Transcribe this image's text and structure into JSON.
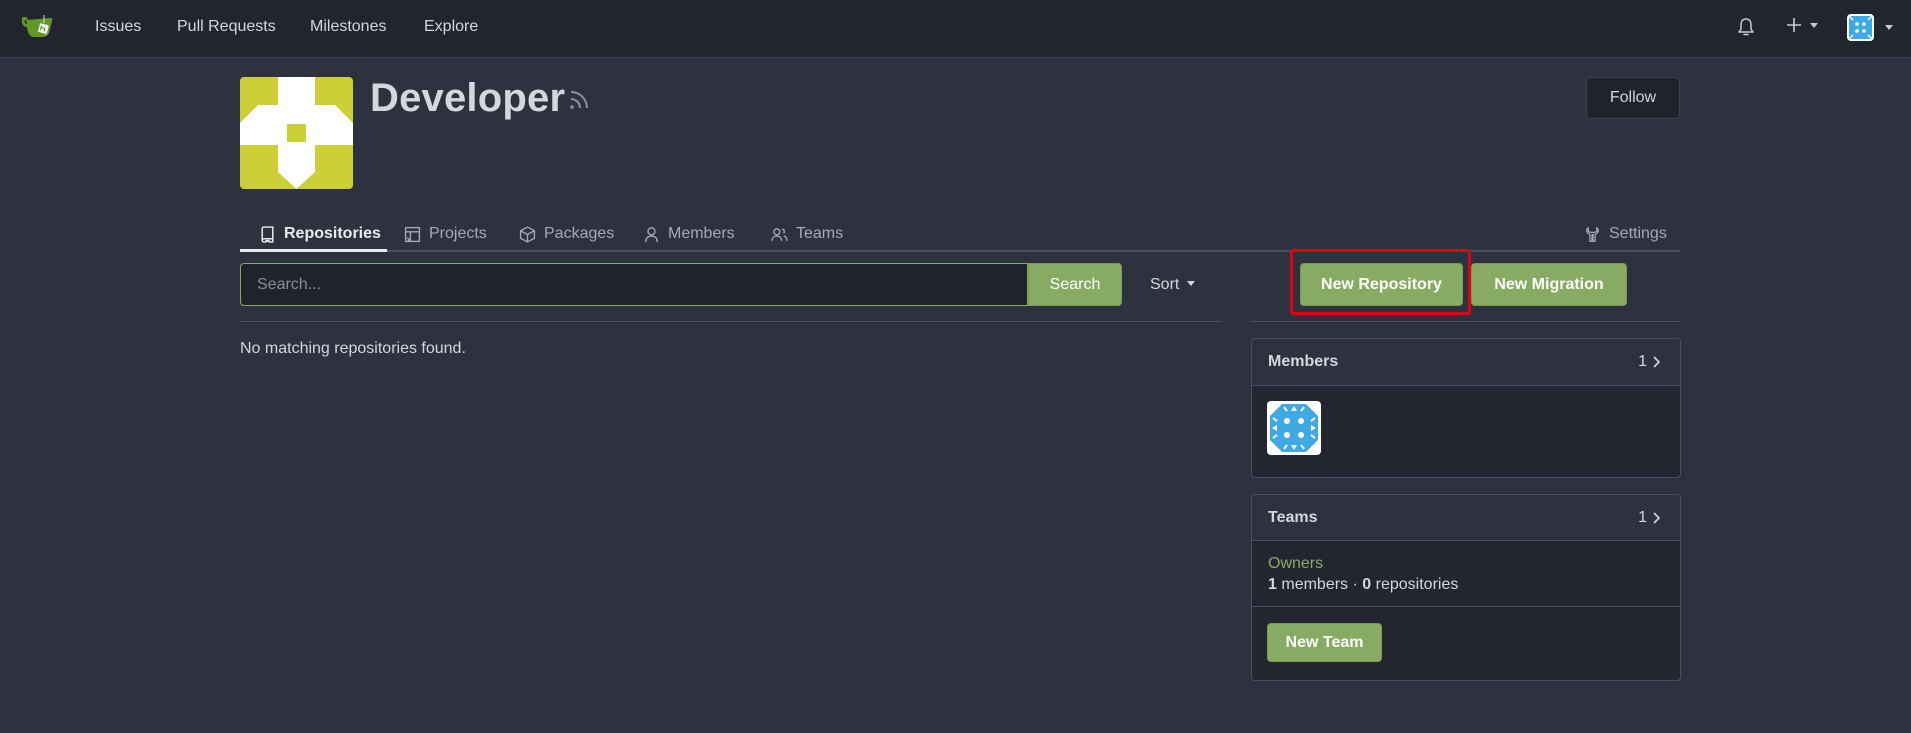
{
  "navbar": {
    "links": [
      "Issues",
      "Pull Requests",
      "Milestones",
      "Explore"
    ],
    "icons": {
      "logo": "gitea-teacup-logo",
      "notifications": "bell-icon",
      "create": "plus-icon",
      "user_menu": "user-avatar"
    }
  },
  "org": {
    "name": "Developer",
    "follow_label": "Follow",
    "avatar_color": "#cccf35"
  },
  "tabs": [
    {
      "label": "Repositories",
      "icon": "repo-icon",
      "active": true
    },
    {
      "label": "Projects",
      "icon": "project-icon",
      "active": false
    },
    {
      "label": "Packages",
      "icon": "package-icon",
      "active": false
    },
    {
      "label": "Members",
      "icon": "person-icon",
      "active": false
    },
    {
      "label": "Teams",
      "icon": "people-icon",
      "active": false
    },
    {
      "label": "Settings",
      "icon": "tools-icon",
      "active": false
    }
  ],
  "search": {
    "placeholder": "Search...",
    "value": "",
    "button_label": "Search",
    "sort_label": "Sort"
  },
  "repositories": {
    "empty_message": "No matching repositories found."
  },
  "actions": {
    "new_repository": "New Repository",
    "new_migration": "New Migration"
  },
  "members_card": {
    "title": "Members",
    "count": "1"
  },
  "teams_card": {
    "title": "Teams",
    "count": "1",
    "teams": [
      {
        "name": "Owners",
        "members": "1",
        "members_label": "members",
        "separator": "·",
        "repos": "0",
        "repos_label": "repositories"
      }
    ],
    "new_team_label": "New Team"
  },
  "colors": {
    "accent": "#87ab63",
    "background": "#2e323e",
    "navbar": "#22252f",
    "highlight": "#e3000f"
  }
}
